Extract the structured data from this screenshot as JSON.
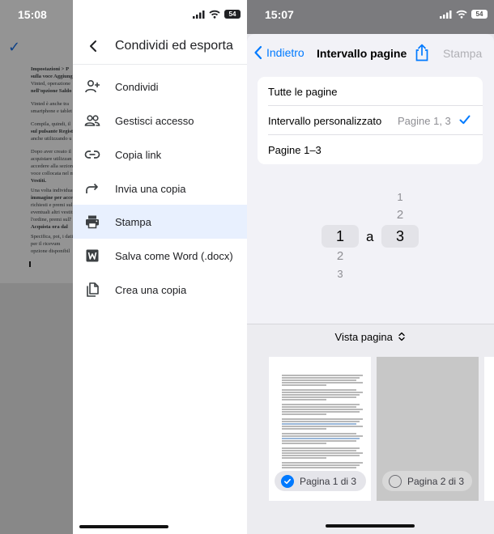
{
  "left": {
    "status": {
      "time": "15:08",
      "battery": "54"
    },
    "drawer": {
      "title": "Condividi ed esporta",
      "items": [
        {
          "label": "Condividi",
          "icon": "add-person-icon"
        },
        {
          "label": "Gestisci accesso",
          "icon": "people-icon"
        },
        {
          "label": "Copia link",
          "icon": "link-icon"
        },
        {
          "label": "Invia una copia",
          "icon": "forward-arrow-icon"
        },
        {
          "label": "Stampa",
          "icon": "printer-icon",
          "selected": true
        },
        {
          "label": "Salva come Word (.docx)",
          "icon": "word-icon"
        },
        {
          "label": "Crea una copia",
          "icon": "copy-icon"
        }
      ]
    },
    "document_fragments": [
      "Impostazioni > P",
      "sulla voce Aggiung",
      "Vinted, operazione",
      "nell'opzione Saldo",
      "Vinted è anche tra",
      "smartphone e tablet",
      "Compila, quindi, il",
      "sul pulsante Regist",
      "anche utilizzando u",
      "Dopo aver creato il",
      "acquistare utilizzan",
      "accedere alla sezion",
      "voce collocata nel m",
      "Vestiti.",
      "Una volta individuat",
      "immagine per acced",
      "richiesti e premi sul",
      "eventuali altri vestit",
      "l'ordine, premi sull'",
      "Acquista ora dal",
      "Specifica, poi, i dati",
      "per il ricevum",
      "opzione disponibil"
    ]
  },
  "right": {
    "status": {
      "time": "15:07",
      "battery": "54"
    },
    "nav": {
      "back_label": "Indietro",
      "title": "Intervallo pagine",
      "print_label": "Stampa"
    },
    "options": [
      {
        "label": "Tutte le pagine",
        "value": ""
      },
      {
        "label": "Intervallo personalizzato",
        "value": "Pagine 1, 3",
        "checked": true
      },
      {
        "label": "Pagine 1–3",
        "value": ""
      }
    ],
    "picker": {
      "from_selected": "1",
      "from_below": [
        "2",
        "3"
      ],
      "separator": "a",
      "to_above": [
        "1",
        "2"
      ],
      "to_selected": "3"
    },
    "preview": {
      "title": "Vista pagina",
      "pages": [
        {
          "label": "Pagina 1 di 3",
          "selected": true
        },
        {
          "label": "Pagina 2 di 3",
          "selected": false
        }
      ]
    }
  },
  "colors": {
    "ios_blue": "#007aff",
    "google_blue": "#1a73e8",
    "selected_row": "#e8f0fe"
  }
}
